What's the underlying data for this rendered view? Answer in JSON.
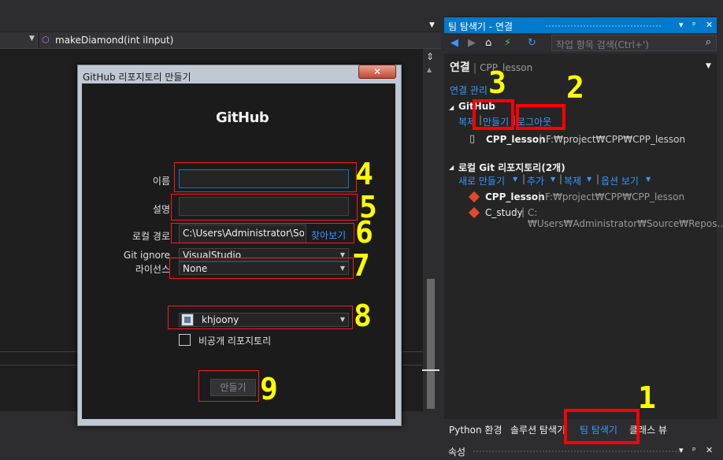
{
  "editor": {
    "member_dropdown": "makeDiamond(int iInput)"
  },
  "team_explorer": {
    "title": "팀 탐색기 - 연결",
    "title_controls": [
      "▾",
      "ᵖ",
      "✕"
    ],
    "search_placeholder": "작업 항목 검색(Ctrl+')",
    "header_main": "연결",
    "header_sub": "CPP_lesson",
    "manage_connections": "연결 관리",
    "github_section": {
      "title": "GitHub",
      "actions": [
        "복제",
        "만들기",
        "로그아웃"
      ],
      "repo_name": "CPP_lesson",
      "repo_path": "F:₩project₩CPP₩CPP_lesson"
    },
    "local_git_section": {
      "title": "로컬 Git 리포지토리(2개)",
      "actions": [
        "새로 만들기",
        "추가",
        "복제",
        "옵션 보기"
      ],
      "repos": [
        {
          "name": "CPP_lesson",
          "path": "F:₩project₩CPP₩CPP_lesson"
        },
        {
          "name": "C_study",
          "path": "C:₩Users₩Administrator₩Source₩Repos..."
        }
      ]
    },
    "bottom_tabs": [
      "Python 환경",
      "솔루션 탐색기",
      "팀 탐색기",
      "클래스 뷰"
    ],
    "properties_title": "속성"
  },
  "dialog": {
    "title": "GitHub 리포지토리 만들기",
    "logo": "GitHub",
    "name_label": "이름",
    "name_value": "",
    "desc_label": "설명",
    "desc_value": "",
    "local_path_label": "로컬 경로",
    "local_path_value": "C:\\Users\\Administrator\\Sour",
    "browse_label": "찾아보기",
    "gitignore_label": "Git ignore",
    "gitignore_value": "VisualStudio",
    "license_label": "라이선스",
    "license_value": "None",
    "account_value": "khjoony",
    "private_label": "비공개 리포지토리",
    "private_checked": false,
    "create_button": "만들기"
  },
  "annotations": [
    "1",
    "2",
    "3",
    "4",
    "5",
    "6",
    "7",
    "8",
    "9"
  ],
  "colors": {
    "accent": "#007acc",
    "link": "#3399ff",
    "annotation_box": "#ff0000",
    "annotation_number": "#ffff00"
  }
}
